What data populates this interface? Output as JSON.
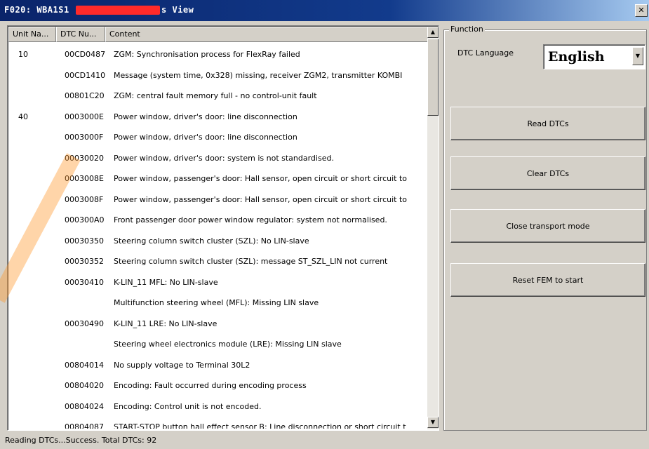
{
  "window": {
    "title_left": "F020: WBA1S1",
    "title_right": "s View",
    "close_glyph": "✕"
  },
  "list": {
    "columns": [
      "Unit Na...",
      "DTC Nu...",
      "Content"
    ],
    "rows": [
      {
        "unit": "10",
        "dtc": "00CD0487",
        "content": "ZGM: Synchronisation process for FlexRay failed"
      },
      {
        "unit": "",
        "dtc": "00CD1410",
        "content": "Message (system time, 0x328) missing, receiver ZGM2, transmitter KOMBI"
      },
      {
        "unit": "",
        "dtc": "00801C20",
        "content": "ZGM: central fault memory full - no control-unit fault"
      },
      {
        "unit": "40",
        "dtc": "0003000E",
        "content": "Power window, driver's door: line disconnection"
      },
      {
        "unit": "",
        "dtc": "0003000F",
        "content": "Power window, driver's door: line disconnection"
      },
      {
        "unit": "",
        "dtc": "00030020",
        "content": "Power window, driver's door: system is not standardised."
      },
      {
        "unit": "",
        "dtc": "0003008E",
        "content": "Power window, passenger's door: Hall sensor, open circuit or short circuit to"
      },
      {
        "unit": "",
        "dtc": "0003008F",
        "content": "Power window, passenger's door: Hall sensor, open circuit or short circuit to"
      },
      {
        "unit": "",
        "dtc": "000300A0",
        "content": "Front passenger door power window regulator: system not normalised."
      },
      {
        "unit": "",
        "dtc": "00030350",
        "content": "Steering column switch cluster (SZL): No LIN-slave"
      },
      {
        "unit": "",
        "dtc": "00030352",
        "content": "Steering column switch cluster (SZL): message ST_SZL_LIN not current"
      },
      {
        "unit": "",
        "dtc": "00030410",
        "content": "K-LIN_11 MFL: No LIN-slave"
      },
      {
        "unit": "",
        "dtc": "",
        "content": "Multifunction steering wheel (MFL): Missing LIN slave"
      },
      {
        "unit": "",
        "dtc": "00030490",
        "content": "K-LIN_11 LRE: No LIN-slave"
      },
      {
        "unit": "",
        "dtc": "",
        "content": "Steering wheel electronics module (LRE): Missing LIN slave"
      },
      {
        "unit": "",
        "dtc": "00804014",
        "content": "No supply voltage to Terminal 30L2"
      },
      {
        "unit": "",
        "dtc": "00804020",
        "content": "Encoding: Fault occurred during encoding process"
      },
      {
        "unit": "",
        "dtc": "00804024",
        "content": "Encoding: Control unit is not encoded."
      },
      {
        "unit": "",
        "dtc": "00804087",
        "content": "START-STOP button hall effect sensor B: Line disconnection or short circuit t"
      }
    ]
  },
  "function": {
    "legend": "Function",
    "language_label": "DTC Language",
    "language_value": "English",
    "buttons": [
      "Read DTCs",
      "Clear DTCs",
      "Close transport mode",
      "Reset FEM to start"
    ]
  },
  "status": {
    "text": "Reading DTCs...Success.  Total DTCs: 92"
  },
  "colors": {
    "titlebar": "#0a246a",
    "face": "#d4d0c8",
    "redaction": "#ff2a2a"
  }
}
